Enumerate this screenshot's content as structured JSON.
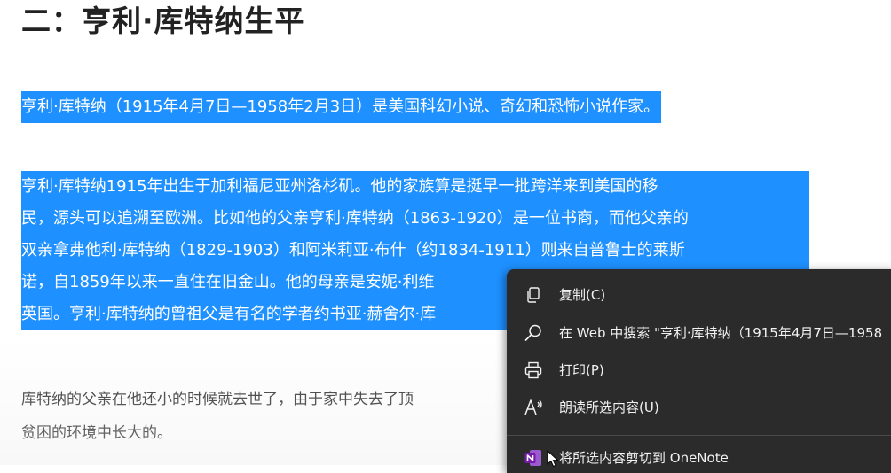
{
  "article": {
    "heading": "二：亨利·库特纳生平",
    "paragraph1": {
      "lines": [
        "亨利·库特纳（1915年4月7日—1958年2月3日）是美国科幻小说、奇幻和恐怖小说作家。"
      ]
    },
    "paragraph2": {
      "lines": [
        "亨利·库特纳1915年出生于加利福尼亚州洛杉矶。他的家族算是挺早一批跨洋来到美国的移",
        "民，源头可以追溯至欧洲。比如他的父亲亨利·库特纳（1863-1920）是一位书商，而他父亲的",
        "双亲拿弗他利·库特纳（1829-1903）和阿米莉亚·布什（约1834-1911）则来自普鲁士的莱斯",
        "诺，自1859年以来一直住在旧金山。他的母亲是安妮·利维",
        "英国。亨利·库特纳的曾祖父是有名的学者约书亚·赫舍尔·库"
      ]
    },
    "paragraph3": {
      "lines": [
        "库特纳的父亲在他还小的时候就去世了，由于家中失去了顶",
        "贫困的环境中长大的。"
      ]
    }
  },
  "context_menu": {
    "items": [
      {
        "icon": "copy-icon",
        "label": "复制(C)"
      },
      {
        "icon": "search-icon",
        "label": "在 Web 中搜索 \"亨利·库特纳（1915年4月7日—1958"
      },
      {
        "icon": "print-icon",
        "label": "打印(P)"
      },
      {
        "icon": "read-aloud-icon",
        "label": "朗读所选内容(U)"
      },
      {
        "icon": "onenote-icon",
        "label": "将所选内容剪切到 OneNote"
      }
    ]
  },
  "colors": {
    "selection": "#1e90ff",
    "menu_background": "#2b2b2b",
    "onenote_purple": "#7719aa"
  }
}
